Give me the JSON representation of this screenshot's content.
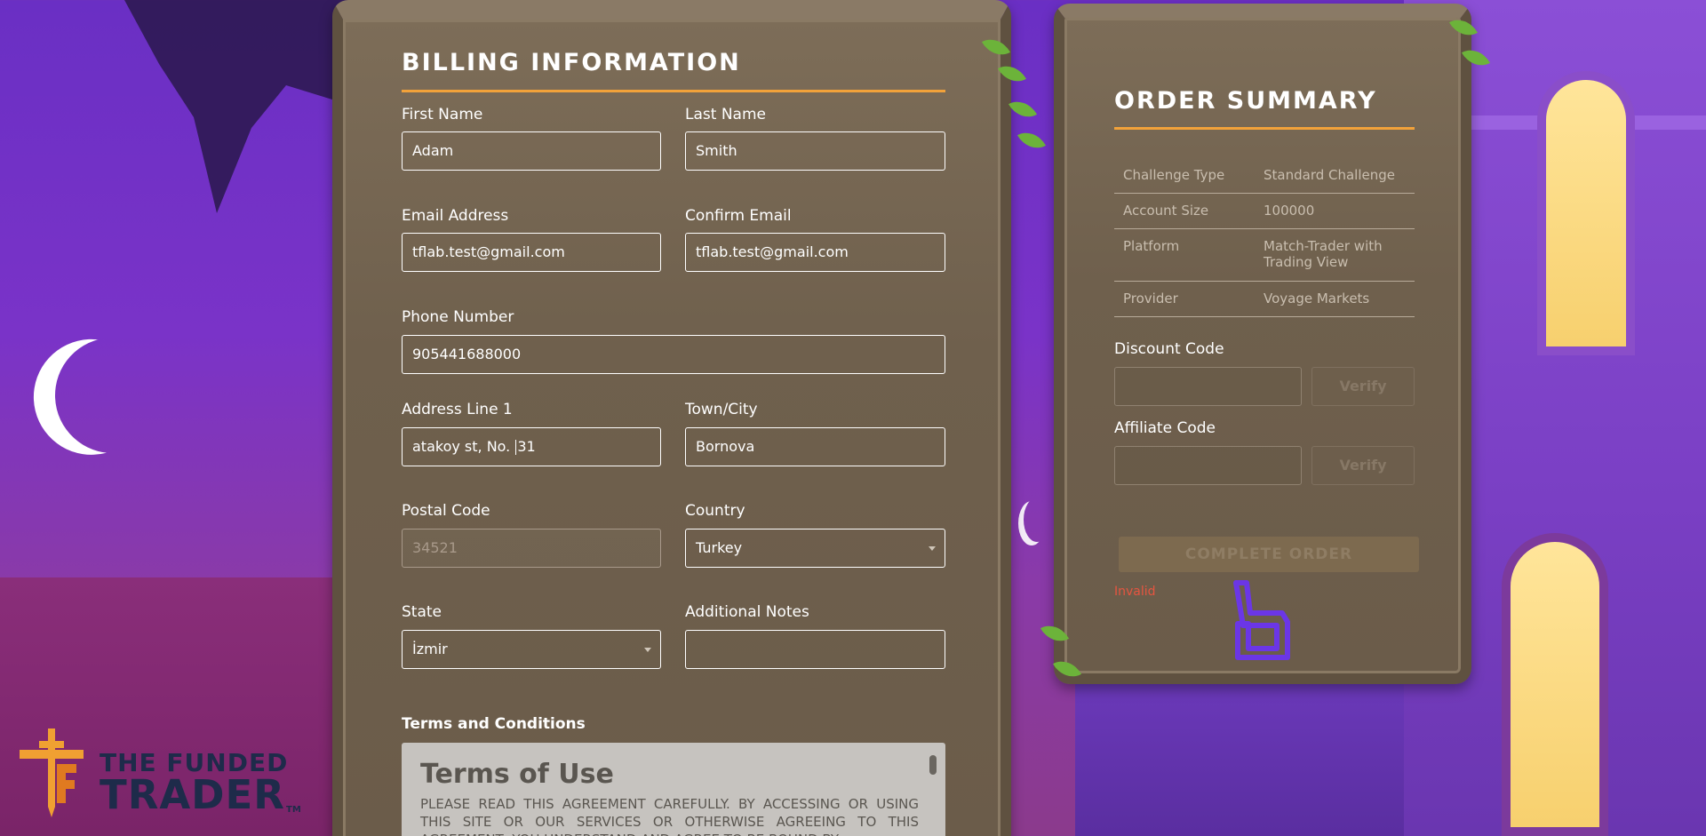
{
  "billing": {
    "title": "BILLING INFORMATION",
    "first_name": {
      "label": "First Name",
      "value": "Adam"
    },
    "last_name": {
      "label": "Last Name",
      "value": "Smith"
    },
    "email": {
      "label": "Email Address",
      "value": "tflab.test@gmail.com"
    },
    "confirm_email": {
      "label": "Confirm Email",
      "value": "tflab.test@gmail.com"
    },
    "phone": {
      "label": "Phone Number",
      "value": "905441688000"
    },
    "address1": {
      "label": "Address Line 1",
      "value_before_caret": "atakoy st, No. ",
      "value_after_caret": "31"
    },
    "city": {
      "label": "Town/City",
      "value": "Bornova"
    },
    "postal": {
      "label": "Postal Code",
      "placeholder": "34521"
    },
    "country": {
      "label": "Country",
      "selected": "Turkey"
    },
    "state": {
      "label": "State",
      "selected": "İzmir"
    },
    "notes": {
      "label": "Additional Notes",
      "value": ""
    },
    "terms": {
      "label": "Terms and Conditions",
      "heading": "Terms of Use",
      "body": "PLEASE READ THIS AGREEMENT CAREFULLY. BY ACCESSING OR USING THIS SITE OR OUR SERVICES OR OTHERWISE AGREEING TO THIS AGREEMENT, YOU UNDERSTAND AND AGREE TO BE BOUND BY"
    }
  },
  "summary": {
    "title": "ORDER SUMMARY",
    "rows": [
      {
        "key": "Challenge Type",
        "value": "Standard Challenge"
      },
      {
        "key": "Account Size",
        "value": "100000"
      },
      {
        "key": "Platform",
        "value": "Match-Trader with Trading View"
      },
      {
        "key": "Provider",
        "value": "Voyage Markets"
      }
    ],
    "discount": {
      "label": "Discount Code",
      "verify": "Verify"
    },
    "affiliate": {
      "label": "Affiliate Code",
      "verify": "Verify"
    },
    "complete_button": "COMPLETE ORDER",
    "error": "Invalid"
  },
  "brand": {
    "line1": "THE FUNDED",
    "line2": "TRADER",
    "tm": "TM"
  },
  "colors": {
    "accent": "#f2a23a",
    "error": "#e65540",
    "logo_navy": "#1e2b4a",
    "logo_orange": "#f0a032",
    "watermark": "#6b36e6"
  },
  "icons": [
    "vine-leaf-icon",
    "select-chevron-icon",
    "brand-sword-icon",
    "watermark-icon"
  ]
}
